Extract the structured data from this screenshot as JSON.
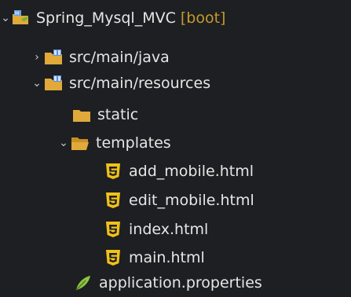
{
  "tree": {
    "project": {
      "label": "Spring_Mysql_MVC",
      "suffix": "[boot]",
      "icon": "spring-project-icon"
    },
    "items": [
      {
        "label": "src/main/java",
        "expanded": false,
        "icon": "source-folder-icon"
      },
      {
        "label": "src/main/resources",
        "expanded": true,
        "icon": "source-folder-icon"
      },
      {
        "label": "static",
        "icon": "folder-icon"
      },
      {
        "label": "templates",
        "expanded": true,
        "icon": "folder-open-icon"
      },
      {
        "label": "add_mobile.html",
        "icon": "html5-icon"
      },
      {
        "label": "edit_mobile.html",
        "icon": "html5-icon"
      },
      {
        "label": "index.html",
        "icon": "html5-icon"
      },
      {
        "label": "main.html",
        "icon": "html5-icon"
      },
      {
        "label": "application.properties",
        "icon": "properties-icon"
      }
    ]
  },
  "colors": {
    "background": "#1e1f22",
    "text": "#e6e6e6",
    "boot_suffix": "#c49a2c",
    "folder": "#e0a93a",
    "html5": "#f0c21a"
  }
}
